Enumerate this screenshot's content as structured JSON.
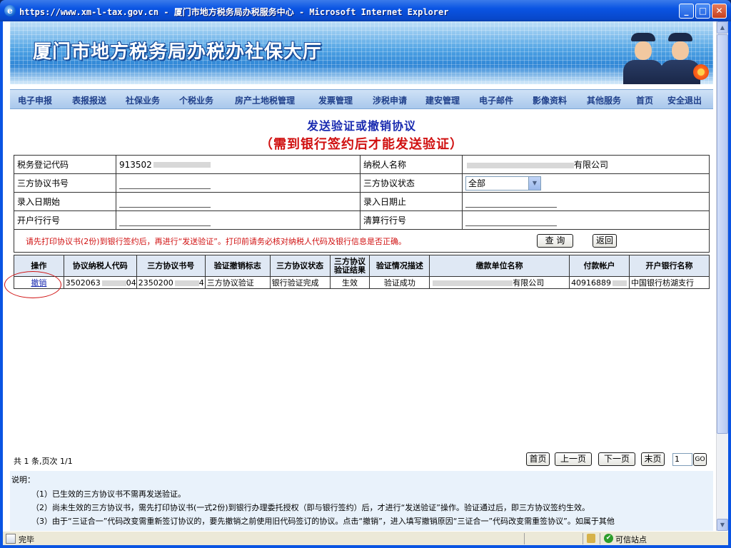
{
  "window": {
    "title": "https://www.xm-l-tax.gov.cn - 厦门市地方税务局办税服务中心 - Microsoft Internet Explorer",
    "minimize": "_",
    "maximize": "□",
    "close": "✕"
  },
  "banner": {
    "title": "厦门市地方税务局办税办社保大厅"
  },
  "nav": [
    "电子申报",
    "表报报送",
    "社保业务",
    "个税业务",
    "房产土地税管理",
    "发票管理",
    "涉税申请",
    "建安管理",
    "电子邮件",
    "影像资料",
    "其他服务",
    "首页",
    "安全退出"
  ],
  "heading": {
    "line1": "发送验证或撤销协议",
    "line2": "（需到银行签约后才能发送验证）"
  },
  "form": {
    "tax_code_label": "税务登记代码",
    "tax_code_value": "913502",
    "taxpayer_name_label": "纳税人名称",
    "taxpayer_name_value": "有限公司",
    "agreement_no_label": "三方协议书号",
    "agreement_status_label": "三方协议状态",
    "agreement_status_value": "全部",
    "date_start_label": "录入日期始",
    "date_end_label": "录入日期止",
    "bank_no_label": "开户行行号",
    "clearing_no_label": "清算行行号",
    "hint": "请先打印协议书(2份)到银行签约后，再进行“发送验证”。打印前请务必核对纳税人代码及银行信息是否正确。",
    "query_button": "查 询",
    "back_button": "返回"
  },
  "results": {
    "headers": [
      "操作",
      "协议纳税人代码",
      "三方协议书号",
      "验证撤销标志",
      "三方协议状态",
      "三方协议验证结果",
      "验证情况描述",
      "缴款单位名称",
      "付款帐户",
      "开户银行名称"
    ],
    "rows": [
      [
        "撤销",
        "3502063",
        "2350200",
        "三方协议验证",
        "银行验证完成",
        "生效",
        "验证成功",
        "有限公司",
        "40916889",
        "中国银行枋湖支行"
      ]
    ],
    "row_suffixes": [
      "",
      "04",
      "4",
      "",
      "",
      "",
      "",
      "",
      "",
      ""
    ]
  },
  "pager": {
    "summary": "共 1 条,页次 1/1",
    "first": "首页",
    "prev": "上一页",
    "next": "下一页",
    "last": "末页",
    "page": "1",
    "go": "GO"
  },
  "notes": {
    "title": "说明：",
    "n1": "（1）已生效的三方协议书不需再发送验证。",
    "n2": "（2）尚未生效的三方协议书，需先打印协议书(一式2份)到银行办理委托授权（即与银行签约）后，才进行“发送验证”操作。验证通过后，即三方协议签约生效。",
    "n3": "（3）由于“三证合一”代码改变需重新签订协议的，要先撤销之前使用旧代码签订的协议。点击“撤销”，进入填写撤销原因“三证合一”代码改变需重签协议”。如属于其他"
  },
  "status": {
    "done": "完毕",
    "zone": "可信站点"
  }
}
